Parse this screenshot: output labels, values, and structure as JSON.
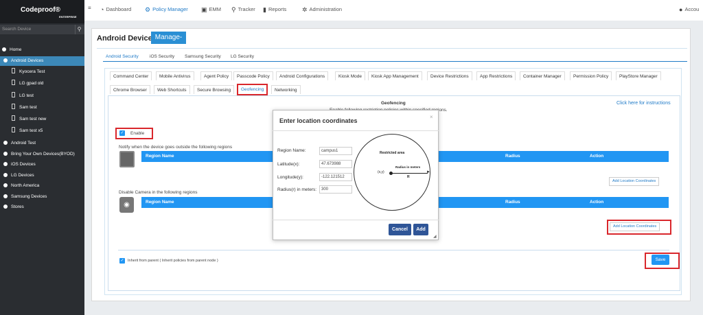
{
  "brand": {
    "title": "Codeproof®",
    "subtitle": "ENTERPRISE"
  },
  "sidebar": {
    "search_placeholder": "Search Device",
    "items": [
      "Home",
      "Android Devices",
      "Kyocera Test",
      "LG gpad old",
      "LG test",
      "Sam test",
      "Sam test new",
      "Sam test x5",
      "Android Test",
      "Bring Your Own Devices(BYOD)",
      "iOS Devices",
      "LG Devices",
      "North America",
      "Samsung Devices",
      "Stores"
    ]
  },
  "topnav": {
    "dashboard": "Dashboard",
    "policy_manager": "Policy Manager",
    "emm": "EMM",
    "tracker": "Tracker",
    "reports": "Reports",
    "administration": "Administration",
    "account": "Accou"
  },
  "page": {
    "title": "Android Devices",
    "manage": "Manage-"
  },
  "os_tabs": [
    "Android Security",
    "iOS Security",
    "Samsung Security",
    "LG Security"
  ],
  "policy_tabs_row1": [
    "Command Center",
    "Mobile Antivirus",
    "Agent Policy",
    "Passcode Policy",
    "Android Configurations",
    "Kiosk Mode",
    "Kiosk App Management",
    "Device Restrictions",
    "App Restrictions",
    "Container Manager",
    "Permission Policy",
    "PlayStore Manager"
  ],
  "policy_tabs_row2": [
    "Chrome Browser",
    "Web Shortcuts",
    "Secure Browsing",
    "Geofencing",
    "Networking"
  ],
  "geofencing": {
    "heading": "Geofencing",
    "subheading": "Enable following restriction policies within specified regions.",
    "instructions_link": "Click here for instructions",
    "enable_label": "Enable",
    "notify_label": "Notify when the device goes outside the following regions",
    "camera_label": "Disable Camera in the following regions",
    "col_region": "Region Name",
    "col_radius": "Radius",
    "col_action": "Action",
    "add_btn": "Add Location Coordinates",
    "inherit_label": "Inherit from parent ( Inherit policies from parent node )",
    "save": "Save"
  },
  "modal": {
    "title": "Enter location coordinates",
    "close": "×",
    "fields": [
      {
        "label": "Region Name:",
        "value": "campus1"
      },
      {
        "label": "Latitude(x):",
        "value": "47.673988"
      },
      {
        "label": "Longitude(y):",
        "value": "-122.121512"
      },
      {
        "label": "Radius(r) in meters:",
        "value": "300"
      }
    ],
    "diagram": {
      "area": "Restricted area",
      "radius": "Radius in meters",
      "point": "(x,y)",
      "r": "R"
    },
    "cancel": "Cancel",
    "add": "Add"
  },
  "colors": {
    "accent": "#2196f3",
    "highlight": "#d9262b",
    "modal_btn": "#2f5597",
    "sidebar_bg": "#2a2d31",
    "sidebar_sel": "#3c88b8"
  }
}
